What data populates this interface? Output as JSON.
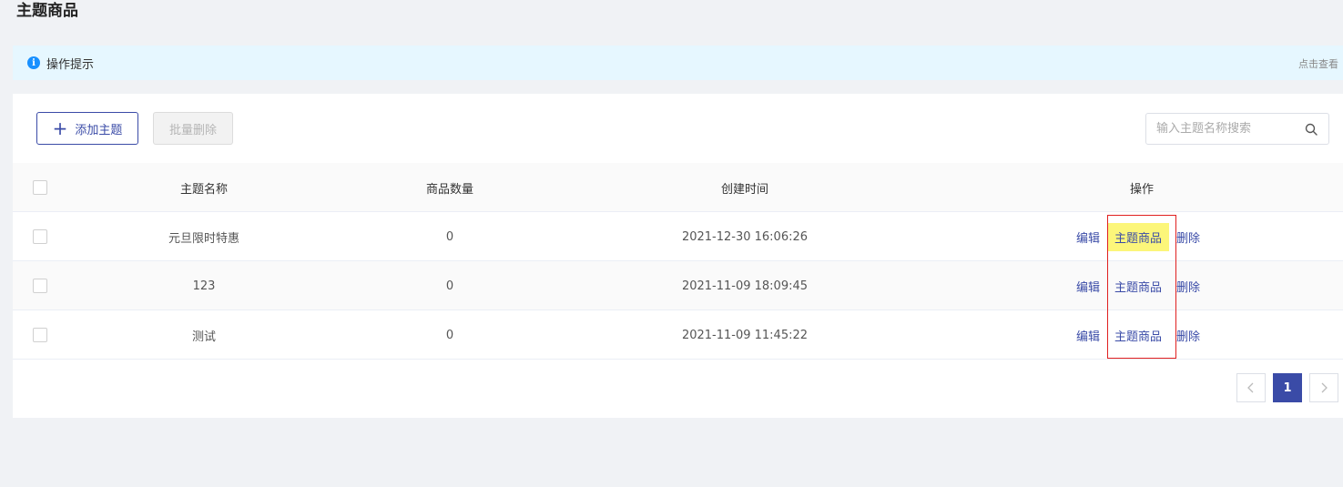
{
  "page": {
    "title": "主题商品"
  },
  "tip": {
    "label": "操作提示",
    "link": "点击查看",
    "icon": "info-icon"
  },
  "toolbar": {
    "add_label": "添加主题",
    "batch_delete_label": "批量删除",
    "search_placeholder": "输入主题名称搜索"
  },
  "table": {
    "headers": {
      "name": "主题名称",
      "count": "商品数量",
      "time": "创建时间",
      "ops": "操作"
    },
    "rows": [
      {
        "name": "元旦限时特惠",
        "count": "0",
        "time": "2021-12-30 16:06:26",
        "edit": "编辑",
        "goods": "主题商品",
        "del": "删除"
      },
      {
        "name": "123",
        "count": "0",
        "time": "2021-11-09 18:09:45",
        "edit": "编辑",
        "goods": "主题商品",
        "del": "删除"
      },
      {
        "name": "测试",
        "count": "0",
        "time": "2021-11-09 11:45:22",
        "edit": "编辑",
        "goods": "主题商品",
        "del": "删除"
      }
    ]
  },
  "pagination": {
    "prev": "<",
    "current": "1",
    "next": ">"
  },
  "colors": {
    "primary": "#3a4ba7",
    "highlight": "#fcf67a",
    "annotation": "#e02020",
    "tip_bg": "#e6f7ff"
  }
}
